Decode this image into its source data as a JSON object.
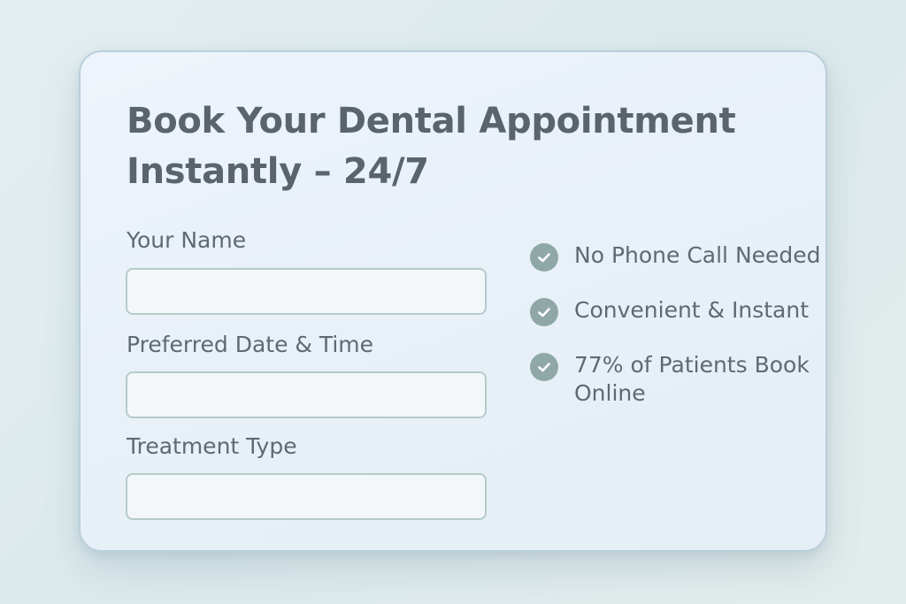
{
  "form": {
    "title_line1": "Book Your Dental Appointment",
    "title_line2": "Instantly – 24/7",
    "fields": [
      {
        "label": "Your Name",
        "value": ""
      },
      {
        "label": "Preferred Date & Time",
        "value": ""
      },
      {
        "label": "Treatment Type",
        "value": ""
      }
    ]
  },
  "benefits": [
    {
      "text": "No Phone Call Needed",
      "icon": "check-circle-icon"
    },
    {
      "text": "Convenient & Instant",
      "icon": "check-circle-icon"
    },
    {
      "text": "77% of Patients Book Online",
      "icon": "check-circle-icon"
    }
  ],
  "colors": {
    "background": "#dfebee",
    "card": "#eaf2f9",
    "card_border": "#b9cfdc",
    "text": "#5e6a72",
    "title": "#5a646c",
    "input_border": "#b3ccc9",
    "check_fill": "#8fa8a7"
  }
}
